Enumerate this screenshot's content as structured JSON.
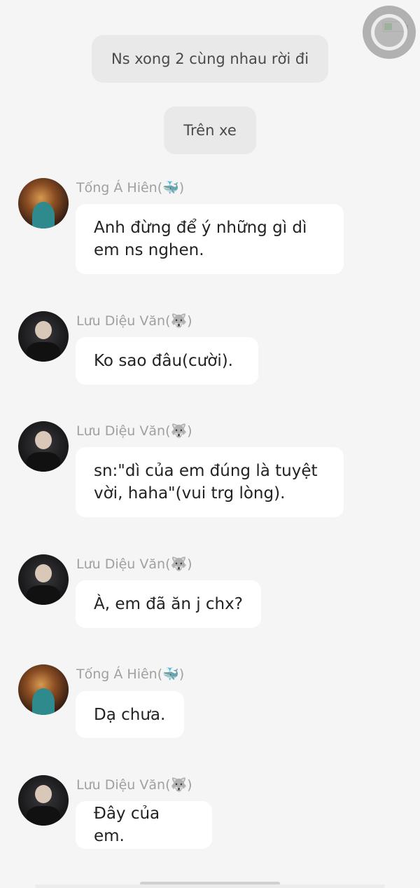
{
  "status_bar": {
    "icons": [
      "battery-icon",
      "assistive-touch-icon"
    ]
  },
  "narrations": [
    {
      "text": "Ns xong 2 cùng nhau rời đi"
    },
    {
      "text": "Trên xe"
    }
  ],
  "messages": [
    {
      "sender": "Tống Á Hiên(🐳)",
      "avatar": "tong-a-hien-avatar",
      "lines": [
        "Anh đừng để ý những gì dì",
        "em ns nghen."
      ]
    },
    {
      "sender": "Lưu Diệu Văn(🐺)",
      "avatar": "luu-dieu-van-avatar",
      "lines": [
        "Ko sao đâu(cười)."
      ]
    },
    {
      "sender": "Lưu Diệu Văn(🐺)",
      "avatar": "luu-dieu-van-avatar",
      "lines": [
        "sn:\"dì của em đúng là tuyệt",
        "vời, haha\"(vui trg lòng)."
      ]
    },
    {
      "sender": "Lưu Diệu Văn(🐺)",
      "avatar": "luu-dieu-van-avatar",
      "lines": [
        "À, em đã ăn j chx?"
      ]
    },
    {
      "sender": "Tống Á Hiên(🐳)",
      "avatar": "tong-a-hien-avatar",
      "lines": [
        "Dạ chưa."
      ]
    },
    {
      "sender": "Lưu Diệu Văn(🐺)",
      "avatar": "luu-dieu-van-avatar",
      "lines": [
        "Đây của em."
      ]
    }
  ]
}
